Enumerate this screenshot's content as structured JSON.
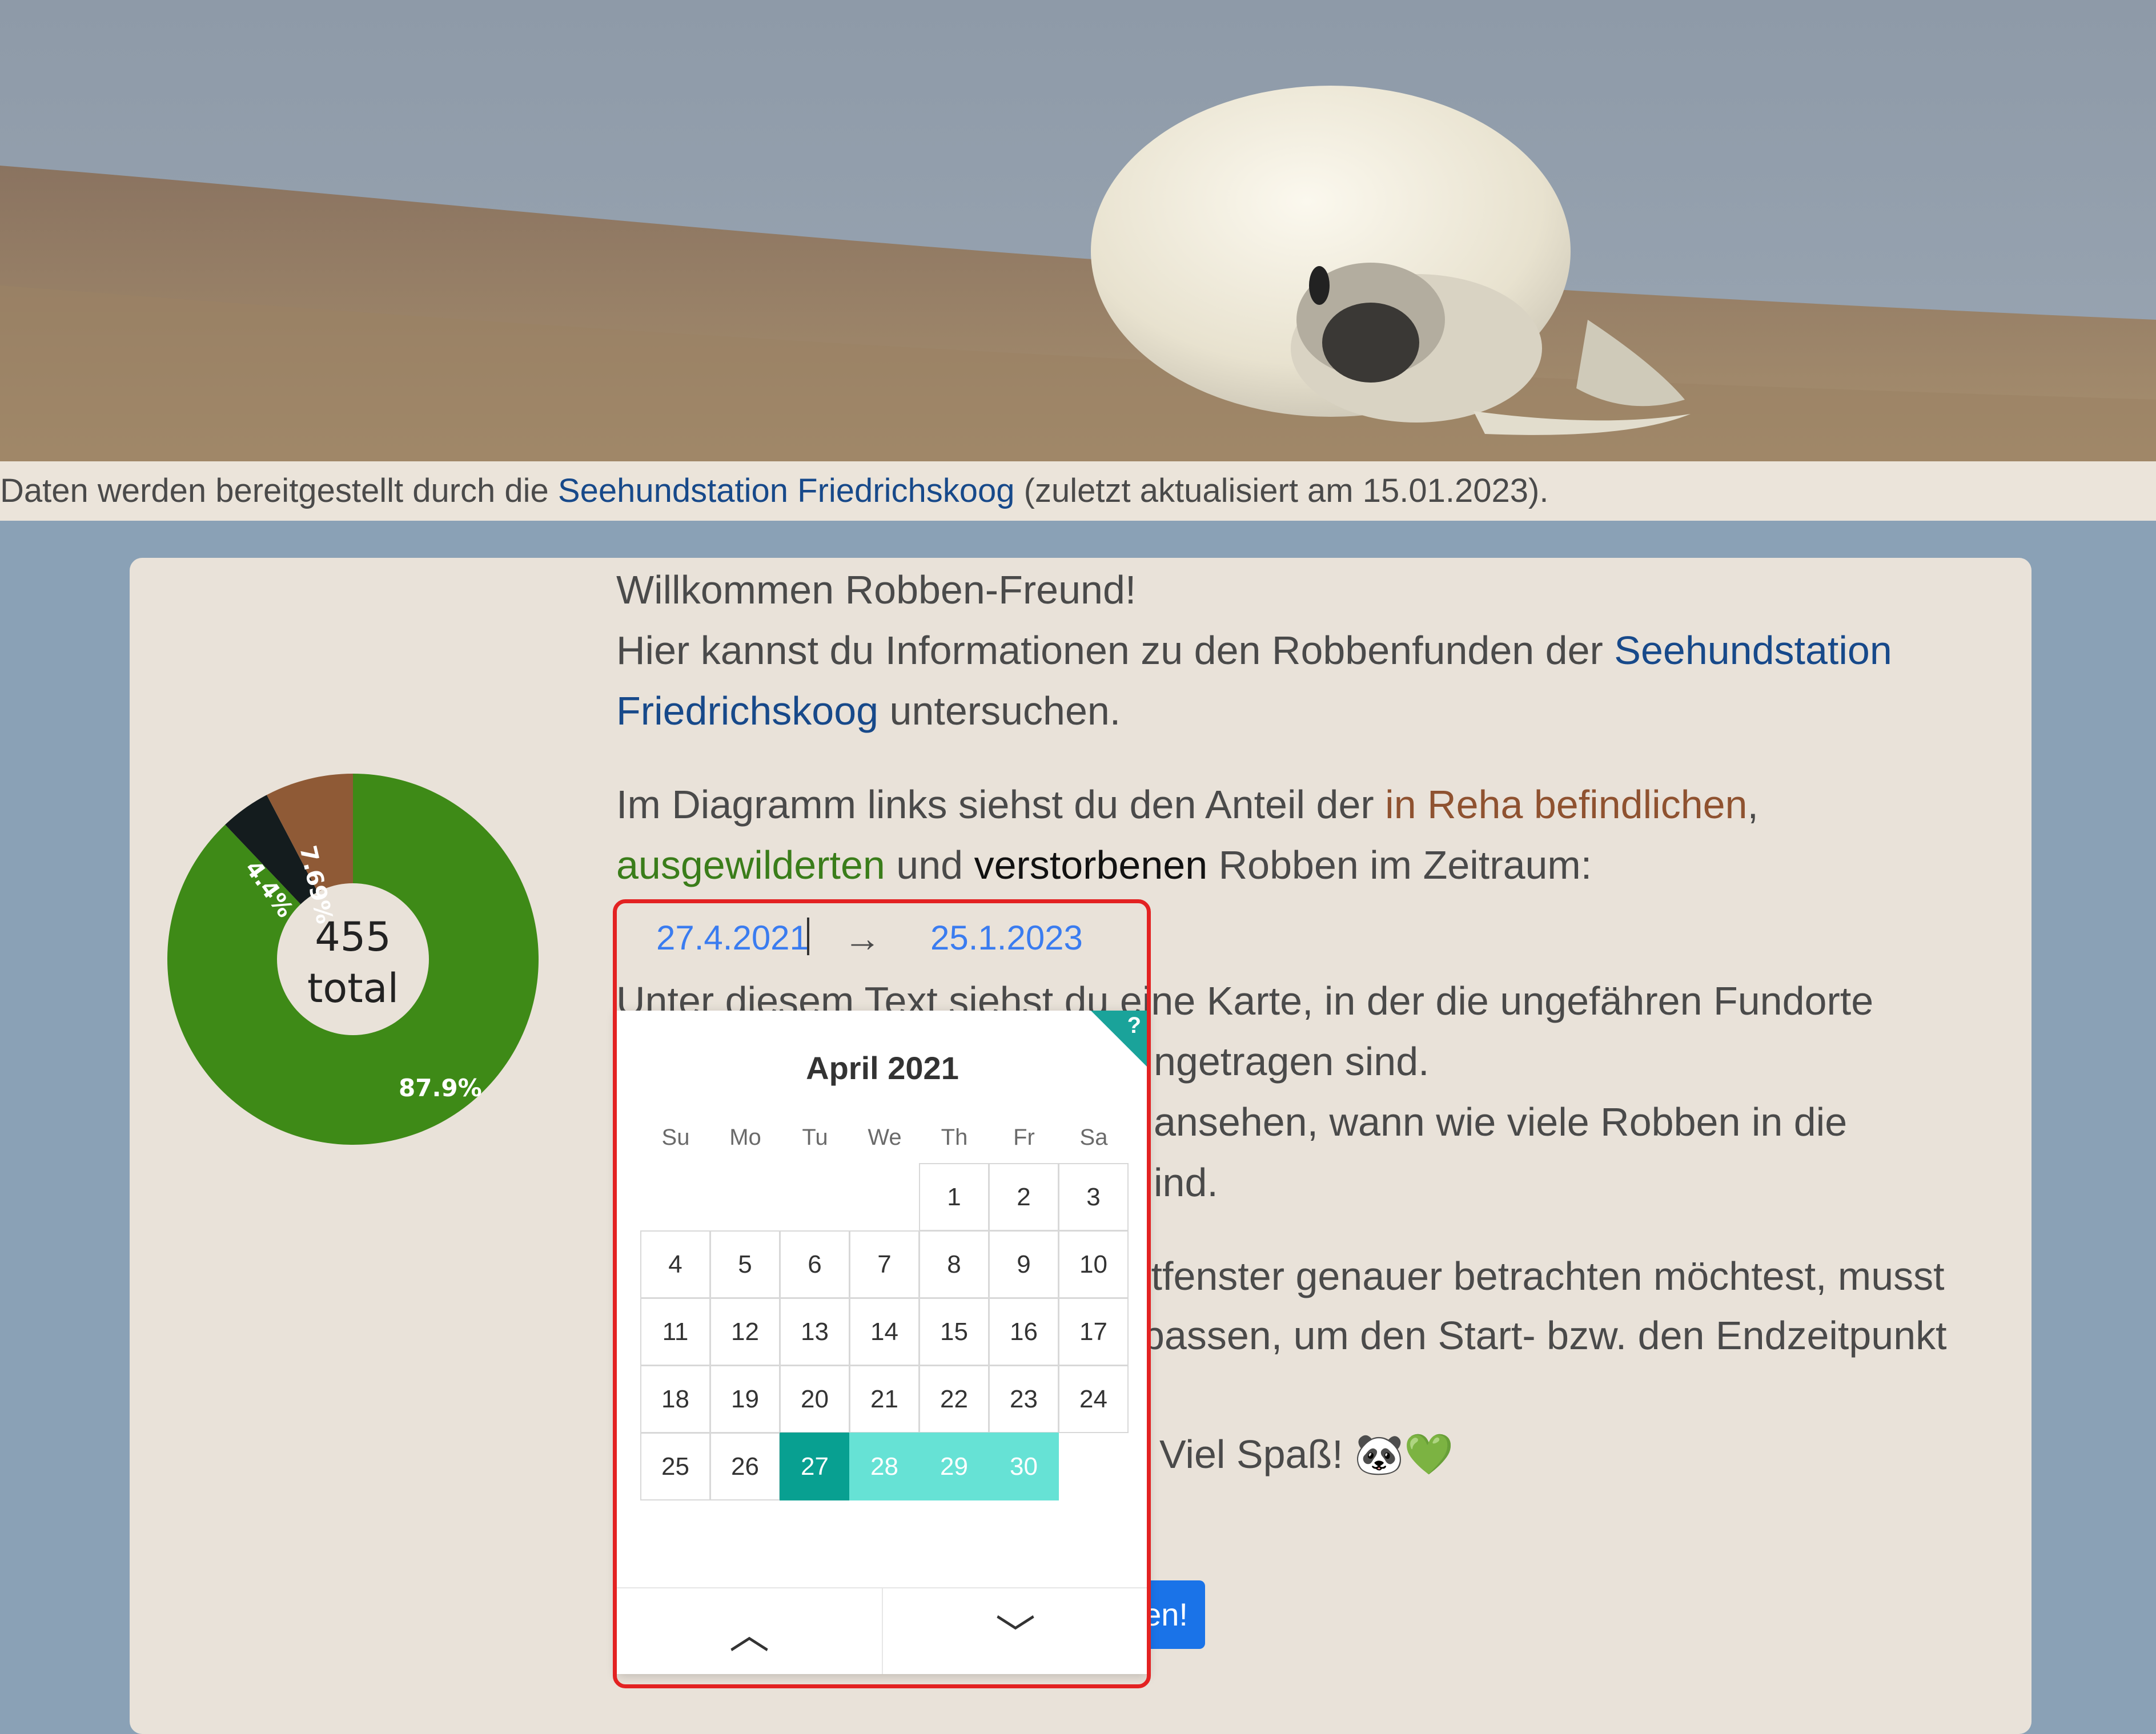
{
  "attribution": {
    "prefix": "Daten werden bereitgestellt durch die ",
    "link": "Seehundstation Friedrichskoog",
    "suffix": " (zuletzt aktualisiert am 15.01.2023)."
  },
  "donut": {
    "center_number": "455",
    "center_label": "total",
    "slice_labels": {
      "ausgewildert": "87.9%",
      "verstorben": "4.4%",
      "reha": "7.69%"
    }
  },
  "chart_data": {
    "type": "pie",
    "categories": [
      "ausgewildert",
      "verstorben",
      "in Reha"
    ],
    "values": [
      87.9,
      4.4,
      7.69
    ],
    "colors": [
      "#3e8a17",
      "#141c1e",
      "#8f5a36"
    ],
    "total_label": "455 total"
  },
  "intro": {
    "line1": "Willkommen Robben-Freund!",
    "line2_prefix": "Hier kannst du Informationen zu den Robbenfunden der ",
    "line2_link": "Seehundstation Friedrichskoog",
    "line2_suffix": " untersuchen."
  },
  "diagram_text": {
    "prefix": "Im Diagramm links siehst du den Anteil der ",
    "reha": "in Reha befindlichen",
    "comma": ",",
    "wild": "ausgewilderten",
    "und": " und ",
    "dead": "verstorbenen",
    "suffix": " Robben im Zeitraum:"
  },
  "daterange": {
    "start": "27.4.2021",
    "arrow": "→",
    "end": "25.1.2023"
  },
  "visible_text": {
    "l1": "Unter diesem Text siehst du eine Karte, in der die ungefähren Fundorte",
    "l2": "ngetragen sind.",
    "l3": "ansehen, wann wie viele Robben in die",
    "l4": "ind.",
    "l5": "itfenster genauer betrachten möchtest, musst",
    "l6": "passen, um den Start- bzw. den Endzeitpunkt",
    "l7": "Viel Spaß! 🐼💚",
    "button": "en!"
  },
  "picker": {
    "help": "?",
    "month_title": "April 2021",
    "weekdays": [
      "Su",
      "Mo",
      "Tu",
      "We",
      "Th",
      "Fr",
      "Sa"
    ],
    "days": [
      [
        "",
        "",
        "",
        "",
        "1",
        "2",
        "3"
      ],
      [
        "4",
        "5",
        "6",
        "7",
        "8",
        "9",
        "10"
      ],
      [
        "11",
        "12",
        "13",
        "14",
        "15",
        "16",
        "17"
      ],
      [
        "18",
        "19",
        "20",
        "21",
        "22",
        "23",
        "24"
      ],
      [
        "25",
        "26",
        "27",
        "28",
        "29",
        "30",
        ""
      ]
    ],
    "selected_day": "27",
    "range_days": [
      "28",
      "29",
      "30"
    ],
    "nav_prev": "︿",
    "nav_next": "﹀"
  }
}
